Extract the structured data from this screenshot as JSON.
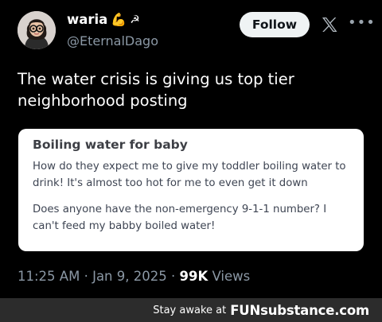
{
  "post": {
    "author": {
      "display_name": "waria",
      "badges": [
        "💪",
        "☭"
      ],
      "handle": "@EternalDago",
      "avatar_icon": "avatar-cartoon-girl-glasses"
    },
    "follow_label": "Follow",
    "brand_icon": "x-logo-icon",
    "more_icon": "more-icon",
    "text": "The water crisis is giving us top tier neighborhood posting",
    "embedded_card": {
      "title": "Boiling water for baby",
      "paragraphs": [
        "How do they expect me to give my toddler boiling water to drink! It's almost too hot for me to even get it down",
        "Does anyone have the non-emergency 9-1-1 number? I can't feed my babby boiled water!"
      ]
    },
    "meta": {
      "time": "11:25 AM",
      "separator": "·",
      "date": "Jan 9, 2025",
      "views_count": "99K",
      "views_label": "Views"
    }
  },
  "watermark": {
    "prefix": "Stay awake at",
    "brand": "FUNsubstance.com"
  },
  "colors": {
    "background": "#000000",
    "follow_button_bg": "#eff3f4",
    "secondary_text": "#8b98a5",
    "card_background": "#ffffff",
    "watermark_bar": "#2c2c2c"
  }
}
